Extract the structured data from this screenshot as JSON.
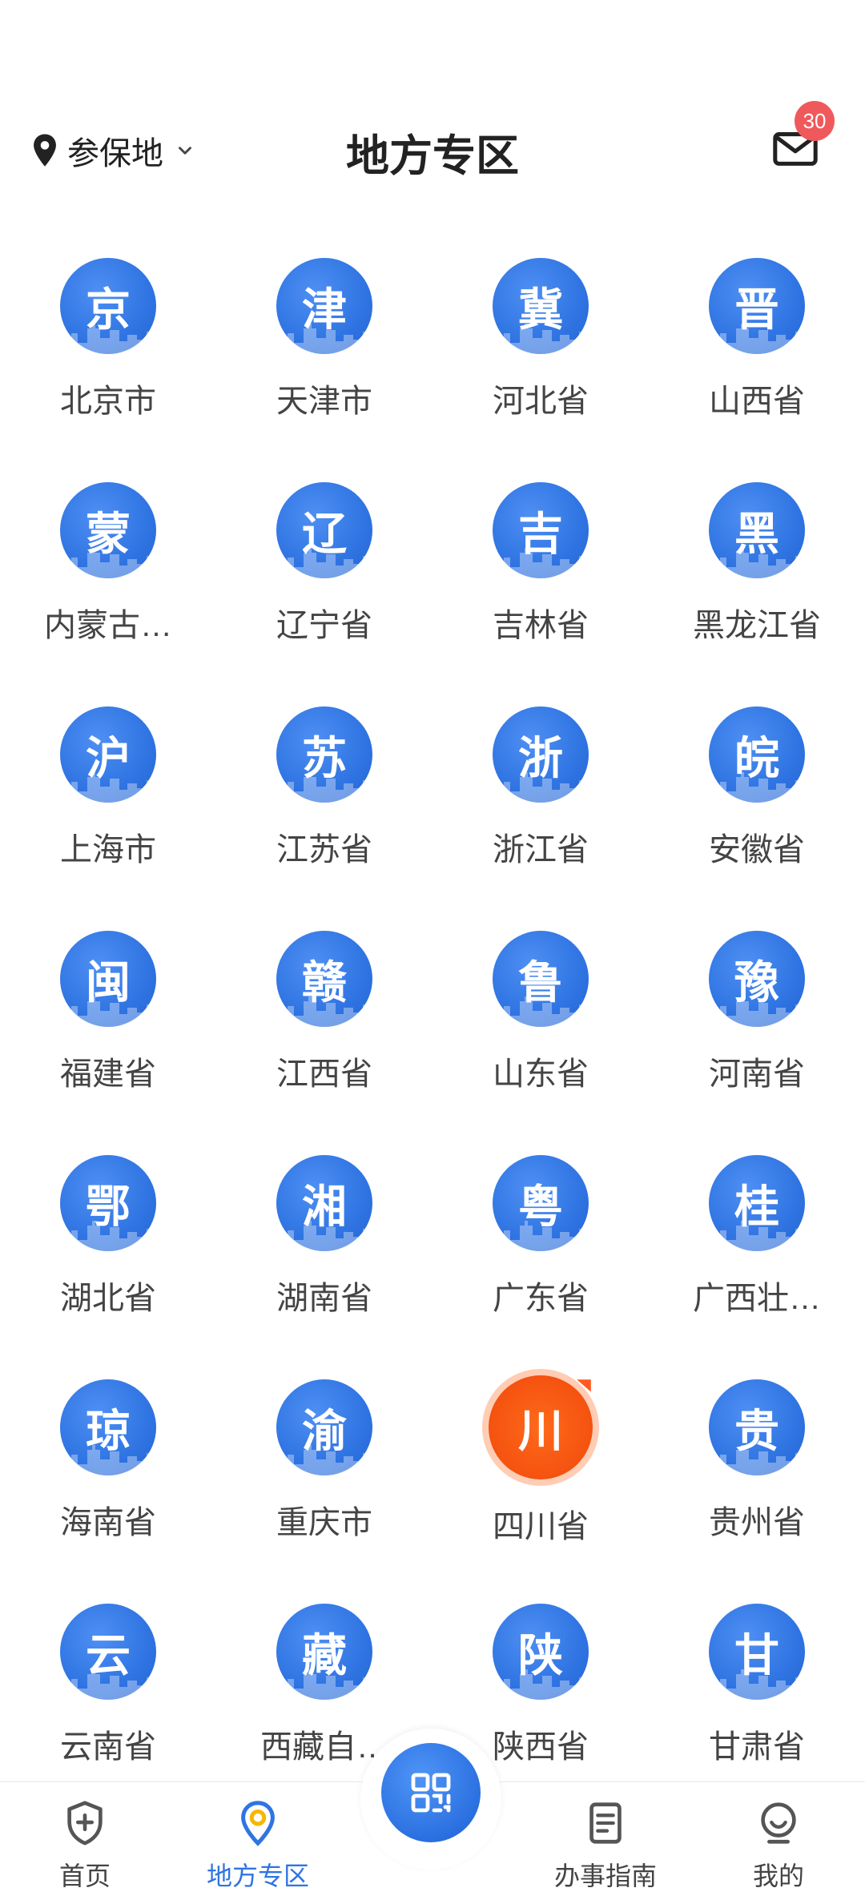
{
  "header": {
    "location_label": "参保地",
    "title": "地方专区",
    "mail_badge": "30",
    "icons": {
      "location": "location-pin-icon",
      "dropdown": "chevron-down-icon",
      "mail": "mail-icon"
    }
  },
  "regions": [
    {
      "glyph": "京",
      "label": "北京市"
    },
    {
      "glyph": "津",
      "label": "天津市"
    },
    {
      "glyph": "冀",
      "label": "河北省"
    },
    {
      "glyph": "晋",
      "label": "山西省"
    },
    {
      "glyph": "蒙",
      "label": "内蒙古…"
    },
    {
      "glyph": "辽",
      "label": "辽宁省"
    },
    {
      "glyph": "吉",
      "label": "吉林省"
    },
    {
      "glyph": "黑",
      "label": "黑龙江省"
    },
    {
      "glyph": "沪",
      "label": "上海市"
    },
    {
      "glyph": "苏",
      "label": "江苏省"
    },
    {
      "glyph": "浙",
      "label": "浙江省"
    },
    {
      "glyph": "皖",
      "label": "安徽省"
    },
    {
      "glyph": "闽",
      "label": "福建省"
    },
    {
      "glyph": "赣",
      "label": "江西省"
    },
    {
      "glyph": "鲁",
      "label": "山东省"
    },
    {
      "glyph": "豫",
      "label": "河南省"
    },
    {
      "glyph": "鄂",
      "label": "湖北省"
    },
    {
      "glyph": "湘",
      "label": "湖南省"
    },
    {
      "glyph": "粤",
      "label": "广东省"
    },
    {
      "glyph": "桂",
      "label": "广西壮…"
    },
    {
      "glyph": "琼",
      "label": "海南省"
    },
    {
      "glyph": "渝",
      "label": "重庆市"
    },
    {
      "glyph": "川",
      "label": "四川省",
      "special": true
    },
    {
      "glyph": "贵",
      "label": "贵州省"
    },
    {
      "glyph": "云",
      "label": "云南省"
    },
    {
      "glyph": "藏",
      "label": "西藏自…"
    },
    {
      "glyph": "陕",
      "label": "陕西省"
    },
    {
      "glyph": "甘",
      "label": "甘肃省"
    }
  ],
  "bottom_nav": {
    "items": [
      {
        "label": "首页",
        "icon": "shield-plus-icon"
      },
      {
        "label": "地方专区",
        "icon": "location-pin-icon",
        "active": true
      },
      {
        "label": "办事指南",
        "icon": "document-icon"
      },
      {
        "label": "我的",
        "icon": "user-smile-icon"
      }
    ],
    "center_button_icon": "qr-code-icon"
  },
  "colors": {
    "accent": "#2f74e2",
    "badge": "#f0595b",
    "special": "#f45210"
  }
}
